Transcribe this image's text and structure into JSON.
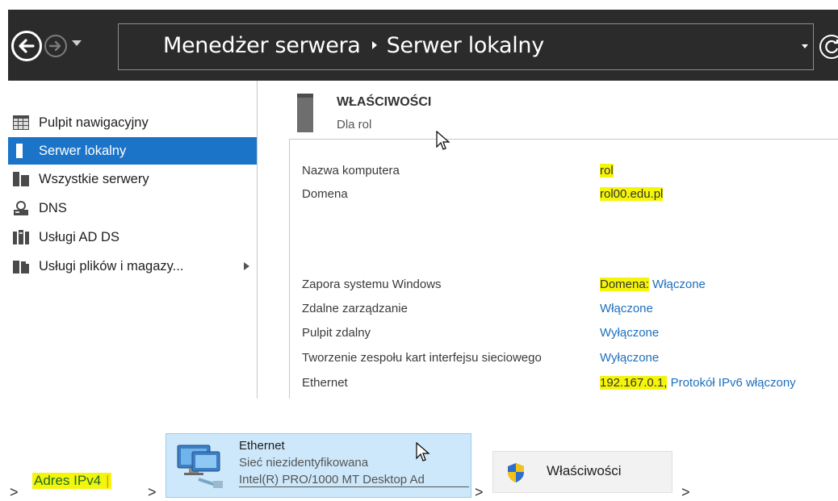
{
  "titlebar": {
    "breadcrumb_root": "Menedżer serwera",
    "breadcrumb_current": "Serwer lokalny"
  },
  "sidebar": {
    "items": [
      {
        "label": "Pulpit nawigacyjny",
        "icon": "dashboard-icon"
      },
      {
        "label": "Serwer lokalny",
        "icon": "server-icon",
        "active": true
      },
      {
        "label": "Wszystkie serwery",
        "icon": "servers-icon"
      },
      {
        "label": "DNS",
        "icon": "dns-icon"
      },
      {
        "label": "Usługi AD DS",
        "icon": "ad-ds-icon"
      },
      {
        "label": "Usługi plików i magazy...",
        "icon": "file-storage-icon"
      }
    ]
  },
  "properties": {
    "title": "WŁAŚCIWOŚCI",
    "subtitle": "Dla rol",
    "rows": [
      {
        "label": "Nazwa komputera",
        "value": "rol"
      },
      {
        "label": "Domena",
        "value": "rol00.edu.pl"
      },
      {
        "label": "Zapora systemu Windows",
        "value_hl": "Domena:",
        "value_rest": " Włączone"
      },
      {
        "label": "Zdalne zarządzanie",
        "value": "Włączone"
      },
      {
        "label": "Pulpit zdalny",
        "value": "Wyłączone"
      },
      {
        "label": "Tworzenie zespołu kart interfejsu sieciowego",
        "value": "Wyłączone"
      },
      {
        "label": "Ethernet",
        "value_hl": "192.167.0.1,",
        "value_rest": " Protokół IPv6 włączony"
      }
    ]
  },
  "steps": {
    "separator": ">",
    "ipv4": "Adres IPv4",
    "ethernet": {
      "name": "Ethernet",
      "network": "Sieć niezidentyfikowana",
      "adapter": "Intel(R) PRO/1000 MT Desktop Ad"
    },
    "properties_button": "Właściwości"
  },
  "colors": {
    "titlebar_bg": "#2b2b2b",
    "active_item": "#1c74c8",
    "link": "#1d6fbd",
    "highlight": "#f5f50a"
  }
}
